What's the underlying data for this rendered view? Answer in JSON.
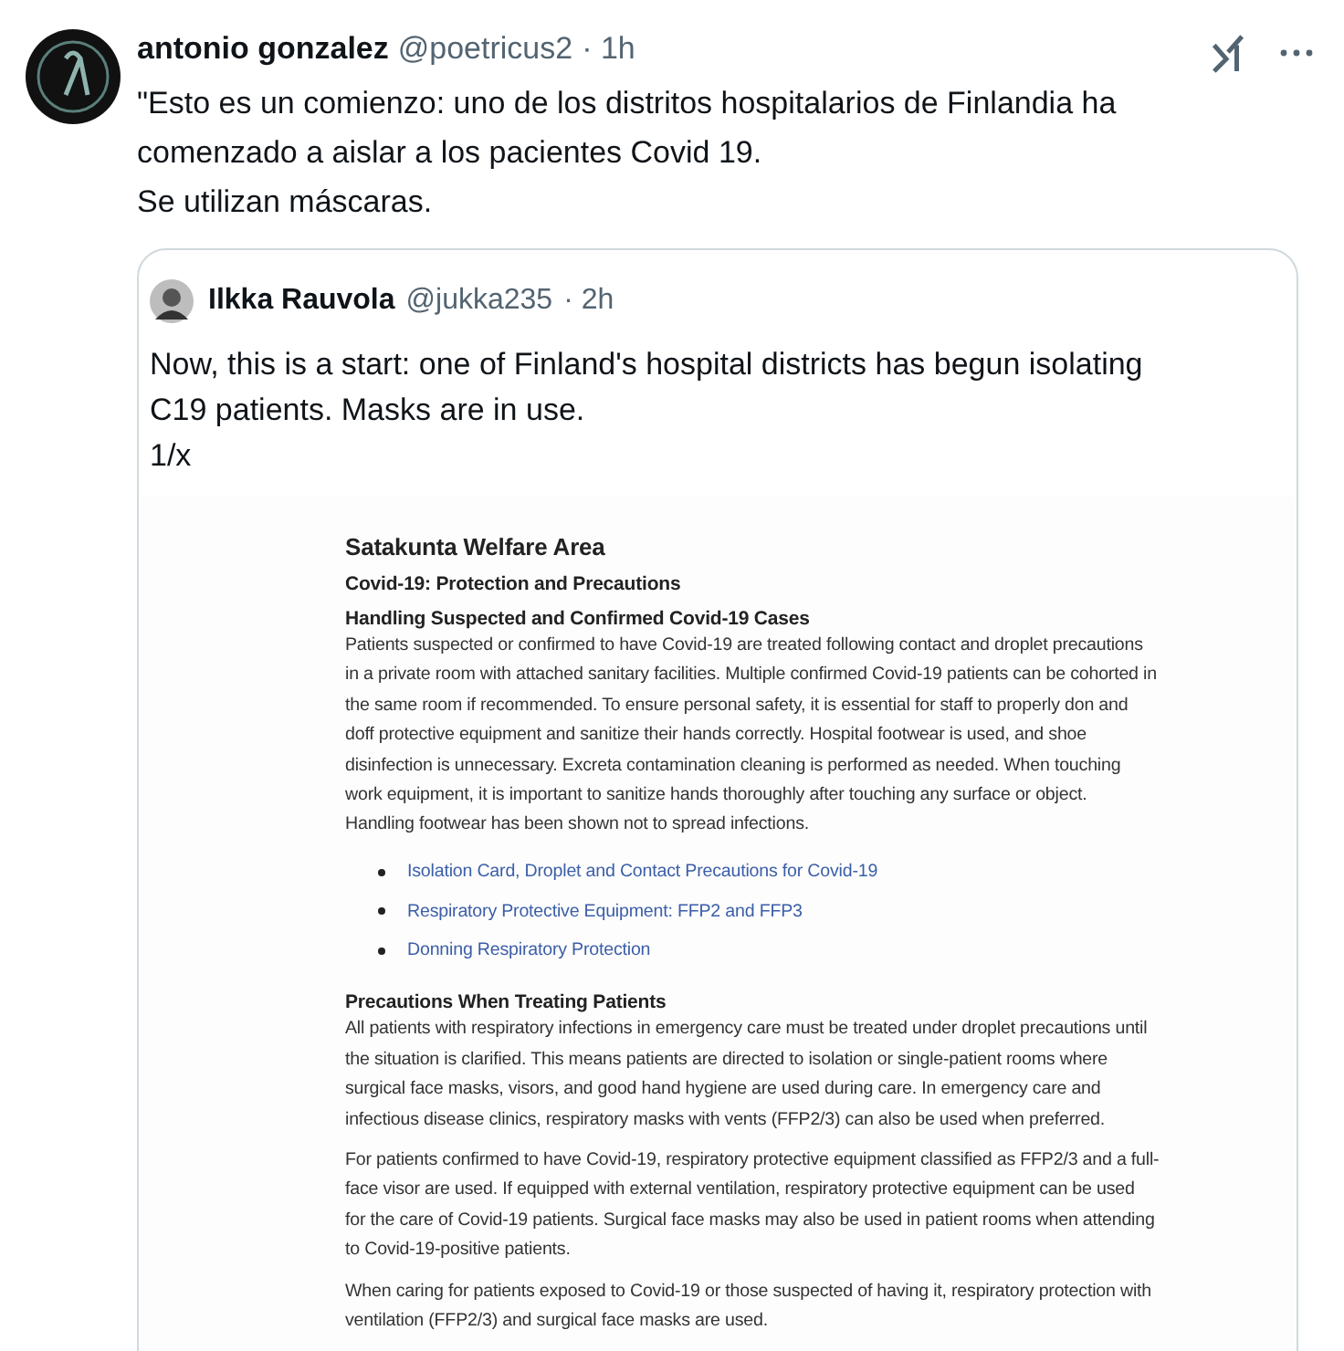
{
  "post": {
    "author": "antonio gonzalez",
    "handle": "@poetricus2",
    "time": "· 1h",
    "text": "\"Esto es un comienzo: uno de los distritos hospitalarios de Finlandia ha\ncomenzado a aislar a los pacientes Covid 19.\nSe utilizan máscaras."
  },
  "quote": {
    "author": "Ilkka Rauvola",
    "handle": "@jukka235",
    "time": "· 2h",
    "text": "Now, this is a start: one of Finland's hospital districts has begun isolating\nC19 patients. Masks are in use.\n1/x",
    "document": {
      "title": "Satakunta Welfare Area",
      "subtitle": "Covid-19: Protection and Precautions",
      "sections": [
        {
          "heading": "Handling Suspected and Confirmed Covid-19 Cases",
          "paragraphs": [
            "Patients suspected or confirmed to have Covid-19 are treated following contact and droplet precautions in a private room with attached sanitary facilities. Multiple confirmed Covid-19 patients can be cohorted in the same room if recommended. To ensure personal safety, it is essential for staff to properly don and doff protective equipment and sanitize their hands correctly. Hospital footwear is used, and shoe disinfection is unnecessary. Excreta contamination cleaning is performed as needed. When touching work equipment, it is important to sanitize hands thoroughly after touching any surface or object. Handling footwear has been shown not to spread infections."
          ],
          "links": [
            "Isolation Card, Droplet and Contact Precautions for Covid-19",
            "Respiratory Protective Equipment: FFP2 and FFP3",
            "Donning Respiratory Protection"
          ]
        },
        {
          "heading": "Precautions When Treating Patients",
          "paragraphs": [
            "All patients with respiratory infections in emergency care must be treated under droplet precautions until the situation is clarified. This means patients are directed to isolation or single-patient rooms where surgical face masks, visors, and good hand hygiene are used during care. In emergency care and infectious disease clinics, respiratory masks with vents (FFP2/3) can also be used when preferred.",
            "For patients confirmed to have Covid-19, respiratory protective equipment classified as FFP2/3 and a full-face visor are used. If equipped with external ventilation, respiratory protective equipment can be used for the care of Covid-19 patients. Surgical face masks may also be used in patient rooms when attending to Covid-19-positive patients.",
            "When caring for patients exposed to Covid-19 or those suspected of having it, respiratory protection with ventilation (FFP2/3) and surgical face masks are used."
          ]
        }
      ]
    }
  }
}
